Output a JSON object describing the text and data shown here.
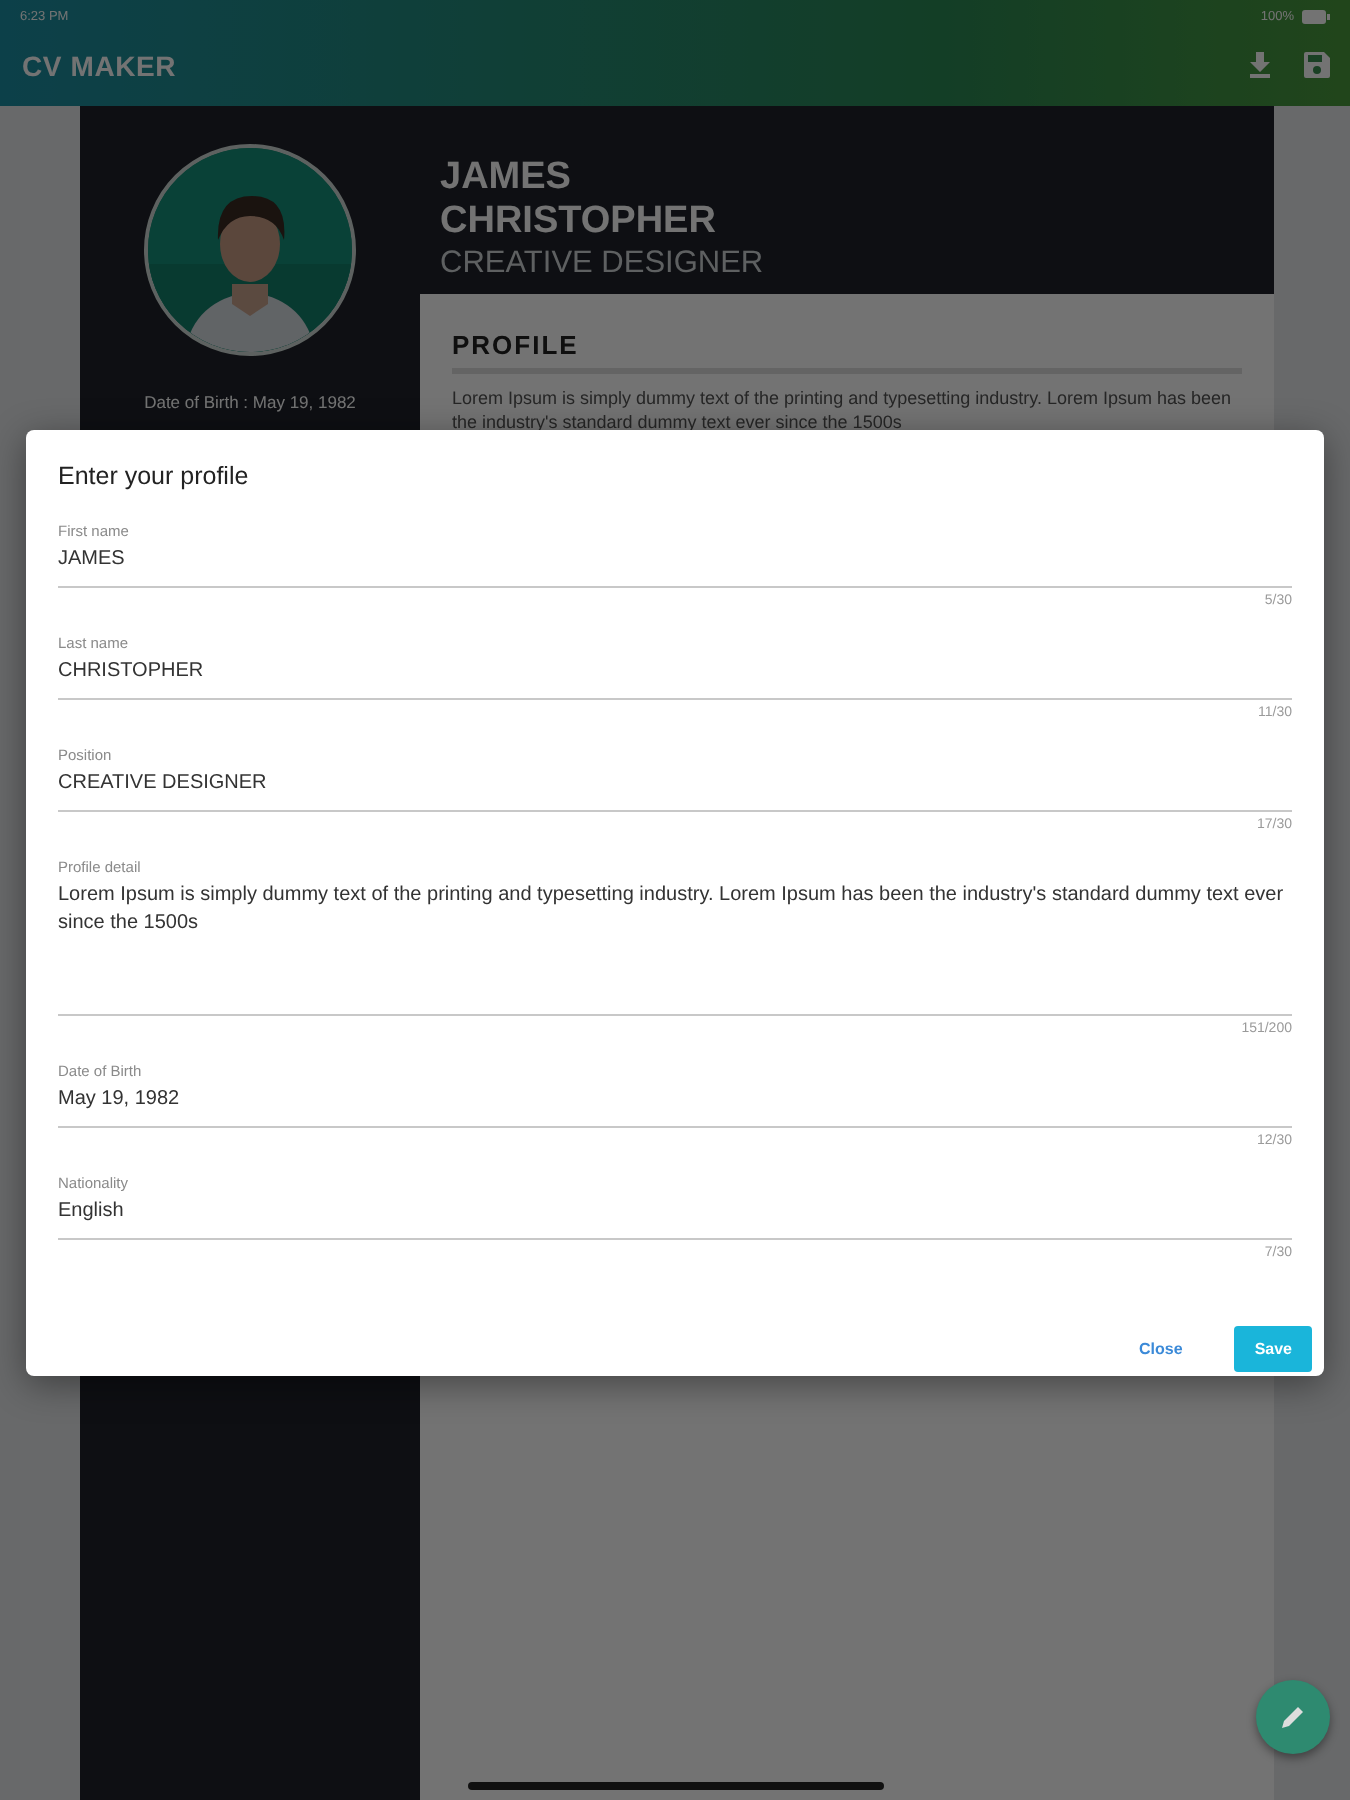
{
  "status_bar": {
    "time": "6:23 PM",
    "battery": "100%"
  },
  "app_bar": {
    "title": "CV MAKER"
  },
  "cv": {
    "first_name": "JAMES",
    "last_name": "CHRISTOPHER",
    "position": "CREATIVE DESIGNER",
    "date_of_birth": "Date of Birth : May 19, 1982",
    "profile_heading": "PROFILE",
    "profile_text": "Lorem Ipsum is simply dummy text of the printing and typesetting industry. Lorem Ipsum has been the industry's standard dummy text ever since the 1500s"
  },
  "dialog": {
    "title": "Enter your profile",
    "fields": [
      {
        "label": "First name",
        "value": "JAMES",
        "counter": "5/30",
        "kind": "line"
      },
      {
        "label": "Last name",
        "value": "CHRISTOPHER",
        "counter": "11/30",
        "kind": "line"
      },
      {
        "label": "Position",
        "value": "CREATIVE DESIGNER",
        "counter": "17/30",
        "kind": "line"
      },
      {
        "label": "Profile detail",
        "value": "Lorem Ipsum is simply dummy text of the printing and typesetting industry. Lorem Ipsum has been the industry's standard dummy text ever since the 1500s",
        "counter": "151/200",
        "kind": "multiline"
      },
      {
        "label": "Date of Birth",
        "value": "May 19, 1982",
        "counter": "12/30",
        "kind": "line"
      },
      {
        "label": "Nationality",
        "value": "English",
        "counter": "7/30",
        "kind": "line"
      }
    ],
    "buttons": [
      {
        "label": "Close",
        "kind": "text"
      },
      {
        "label": "Save",
        "kind": "filled"
      }
    ]
  }
}
